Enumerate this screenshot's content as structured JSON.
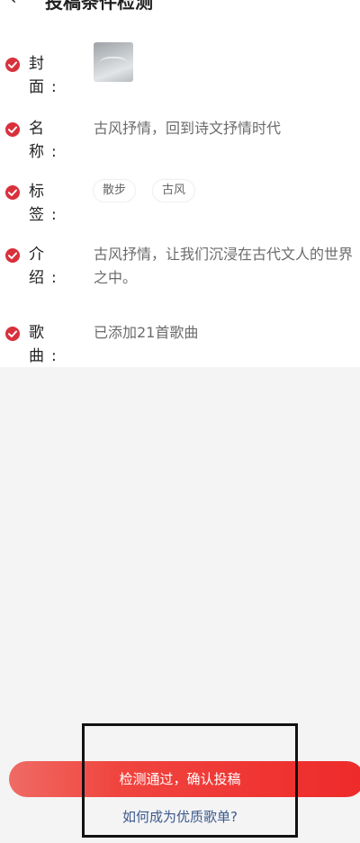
{
  "header": {
    "title": "投稿条件检测",
    "back_icon": "chevron-left-icon"
  },
  "form": {
    "cover": {
      "label": "封面:"
    },
    "name": {
      "label": "名称:",
      "value": "古风抒情，回到诗文抒情时代"
    },
    "tags": {
      "label": "标签:",
      "items": [
        "散步",
        "古风"
      ]
    },
    "intro": {
      "label": "介绍:",
      "value": "古风抒情，让我们沉浸在古代文人的世界之中。"
    },
    "songs": {
      "label": "歌曲:",
      "value": "已添加21首歌曲"
    }
  },
  "footer": {
    "confirm_label": "检测通过，确认投稿",
    "help_link": "如何成为优质歌单?"
  },
  "colors": {
    "accent": "#ee2a2a",
    "check": "#d9313c",
    "link": "#3c5a8c"
  }
}
